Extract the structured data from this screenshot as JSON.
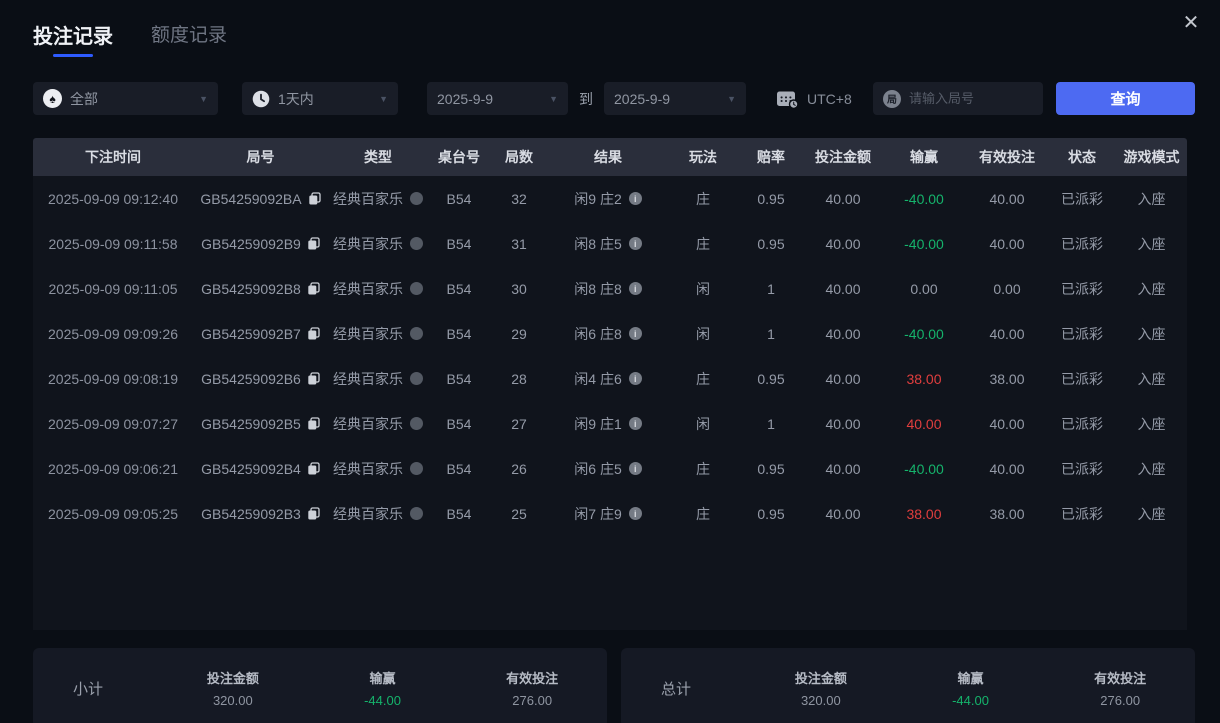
{
  "window": {
    "tabs": [
      {
        "label": "投注记录",
        "active": true
      },
      {
        "label": "额度记录",
        "active": false
      }
    ]
  },
  "filters": {
    "game_type": {
      "icon": "spade-icon",
      "value": "全部"
    },
    "time_range": {
      "icon": "clock-icon",
      "value": "1天内"
    },
    "date_from": "2025-9-9",
    "date_separator": "到",
    "date_to": "2025-9-9",
    "timezone": {
      "icon": "calendar-clock-icon",
      "label": "UTC+8"
    },
    "round_input": {
      "icon": "round-number-icon",
      "placeholder": "请输入局号",
      "value": ""
    },
    "query_button": "查询"
  },
  "table": {
    "headers": [
      "下注时间",
      "局号",
      "类型",
      "桌台号",
      "局数",
      "结果",
      "玩法",
      "赔率",
      "投注金额",
      "输赢",
      "有效投注",
      "状态",
      "游戏模式"
    ],
    "rows": [
      {
        "time": "2025-09-09 09:12:40",
        "round_id": "GB54259092BA",
        "type": "经典百家乐",
        "table_no": "B54",
        "round_no": "32",
        "result": "闲9 庄2",
        "play": "庄",
        "odds": "0.95",
        "bet_amount": "40.00",
        "win_loss": "-40.00",
        "win_loss_color": "green",
        "valid_bet": "40.00",
        "status": "已派彩",
        "mode": "入座"
      },
      {
        "time": "2025-09-09 09:11:58",
        "round_id": "GB54259092B9",
        "type": "经典百家乐",
        "table_no": "B54",
        "round_no": "31",
        "result": "闲8 庄5",
        "play": "庄",
        "odds": "0.95",
        "bet_amount": "40.00",
        "win_loss": "-40.00",
        "win_loss_color": "green",
        "valid_bet": "40.00",
        "status": "已派彩",
        "mode": "入座"
      },
      {
        "time": "2025-09-09 09:11:05",
        "round_id": "GB54259092B8",
        "type": "经典百家乐",
        "table_no": "B54",
        "round_no": "30",
        "result": "闲8 庄8",
        "play": "闲",
        "odds": "1",
        "bet_amount": "40.00",
        "win_loss": "0.00",
        "win_loss_color": "neutral",
        "valid_bet": "0.00",
        "status": "已派彩",
        "mode": "入座"
      },
      {
        "time": "2025-09-09 09:09:26",
        "round_id": "GB54259092B7",
        "type": "经典百家乐",
        "table_no": "B54",
        "round_no": "29",
        "result": "闲6 庄8",
        "play": "闲",
        "odds": "1",
        "bet_amount": "40.00",
        "win_loss": "-40.00",
        "win_loss_color": "green",
        "valid_bet": "40.00",
        "status": "已派彩",
        "mode": "入座"
      },
      {
        "time": "2025-09-09 09:08:19",
        "round_id": "GB54259092B6",
        "type": "经典百家乐",
        "table_no": "B54",
        "round_no": "28",
        "result": "闲4 庄6",
        "play": "庄",
        "odds": "0.95",
        "bet_amount": "40.00",
        "win_loss": "38.00",
        "win_loss_color": "red",
        "valid_bet": "38.00",
        "status": "已派彩",
        "mode": "入座"
      },
      {
        "time": "2025-09-09 09:07:27",
        "round_id": "GB54259092B5",
        "type": "经典百家乐",
        "table_no": "B54",
        "round_no": "27",
        "result": "闲9 庄1",
        "play": "闲",
        "odds": "1",
        "bet_amount": "40.00",
        "win_loss": "40.00",
        "win_loss_color": "red",
        "valid_bet": "40.00",
        "status": "已派彩",
        "mode": "入座"
      },
      {
        "time": "2025-09-09 09:06:21",
        "round_id": "GB54259092B4",
        "type": "经典百家乐",
        "table_no": "B54",
        "round_no": "26",
        "result": "闲6 庄5",
        "play": "庄",
        "odds": "0.95",
        "bet_amount": "40.00",
        "win_loss": "-40.00",
        "win_loss_color": "green",
        "valid_bet": "40.00",
        "status": "已派彩",
        "mode": "入座"
      },
      {
        "time": "2025-09-09 09:05:25",
        "round_id": "GB54259092B3",
        "type": "经典百家乐",
        "table_no": "B54",
        "round_no": "25",
        "result": "闲7 庄9",
        "play": "庄",
        "odds": "0.95",
        "bet_amount": "40.00",
        "win_loss": "38.00",
        "win_loss_color": "red",
        "valid_bet": "38.00",
        "status": "已派彩",
        "mode": "入座"
      }
    ]
  },
  "summary": {
    "subtotal": {
      "label": "小计",
      "bet_amount_label": "投注金额",
      "bet_amount": "320.00",
      "win_loss_label": "输赢",
      "win_loss": "-44.00",
      "valid_bet_label": "有效投注",
      "valid_bet": "276.00"
    },
    "total": {
      "label": "总计",
      "bet_amount_label": "投注金额",
      "bet_amount": "320.00",
      "win_loss_label": "输赢",
      "win_loss": "-44.00",
      "valid_bet_label": "有效投注",
      "valid_bet": "276.00"
    }
  },
  "colors": {
    "accent_blue": "#4d6af2",
    "tab_underline": "#2e5bff",
    "win_red": "#e03e3e",
    "loss_green": "#15b36b"
  }
}
